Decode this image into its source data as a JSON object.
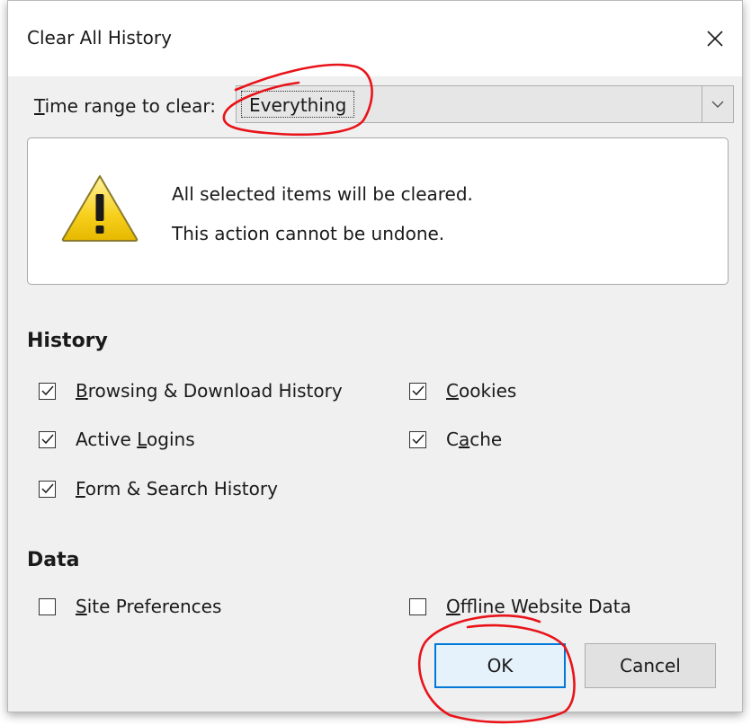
{
  "dialog": {
    "title": "Clear All History"
  },
  "time_range": {
    "label_prefix": "T",
    "label_rest": "ime range to clear:",
    "selected_value": "Everything"
  },
  "warning": {
    "line1": "All selected items will be cleared.",
    "line2": "This action cannot be undone."
  },
  "history": {
    "title": "History",
    "items": [
      {
        "pre": "",
        "key": "B",
        "post": "rowsing & Download History",
        "checked": true
      },
      {
        "pre": "",
        "key": "C",
        "post": "ookies",
        "checked": true
      },
      {
        "pre": "Active ",
        "key": "L",
        "post": "ogins",
        "checked": true
      },
      {
        "pre": "C",
        "key": "a",
        "post": "che",
        "checked": true
      },
      {
        "pre": "",
        "key": "F",
        "post": "orm & Search History",
        "checked": true
      }
    ]
  },
  "data": {
    "title": "Data",
    "items": [
      {
        "pre": "",
        "key": "S",
        "post": "ite Preferences",
        "checked": false
      },
      {
        "pre": "",
        "key": "O",
        "post": "ffline Website Data",
        "checked": false
      }
    ]
  },
  "buttons": {
    "ok_label": "OK",
    "cancel_label": "Cancel"
  },
  "colors": {
    "accent": "#0078d7",
    "annotation": "#e8141a",
    "warning_yellow": "#f7d01c"
  }
}
